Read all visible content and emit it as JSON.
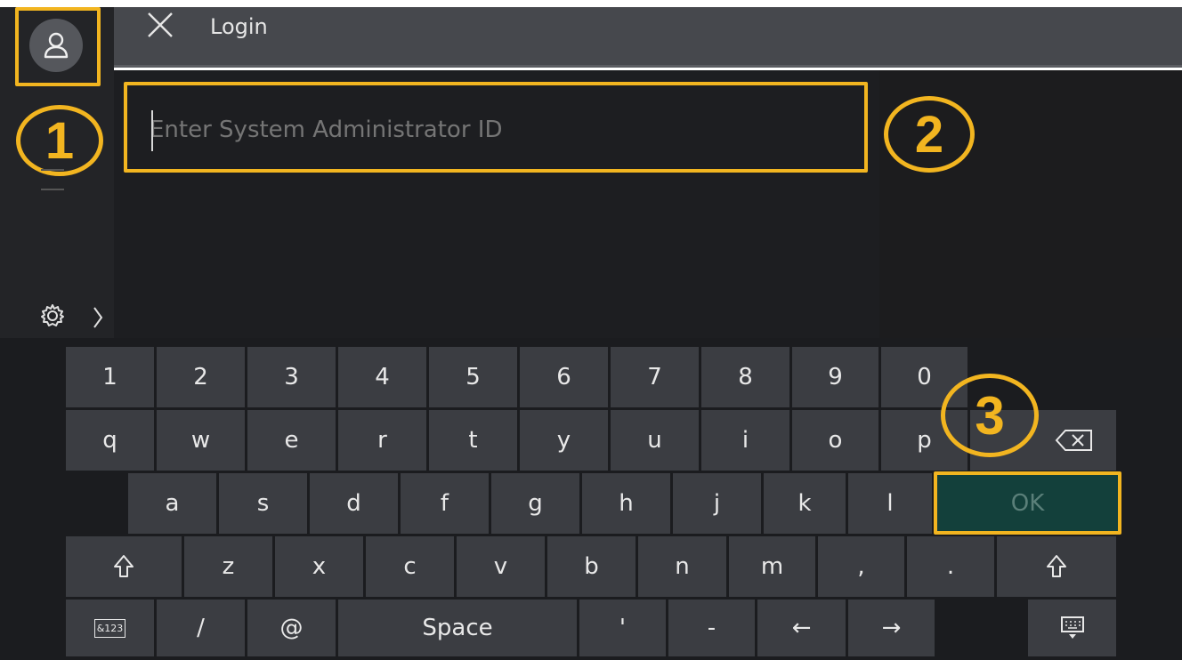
{
  "header": {
    "title": "Login"
  },
  "login": {
    "placeholder": "Enter System Administrator ID"
  },
  "annotations": {
    "one": "1",
    "two": "2",
    "three": "3"
  },
  "keyboard": {
    "row1": [
      "1",
      "2",
      "3",
      "4",
      "5",
      "6",
      "7",
      "8",
      "9",
      "0"
    ],
    "row2": [
      "q",
      "w",
      "e",
      "r",
      "t",
      "y",
      "u",
      "i",
      "o",
      "p"
    ],
    "row3": [
      "a",
      "s",
      "d",
      "f",
      "g",
      "h",
      "j",
      "k",
      "l"
    ],
    "ok_label": "OK",
    "row4": [
      "z",
      "x",
      "c",
      "v",
      "b",
      "n",
      "m",
      ",",
      "."
    ],
    "row5": {
      "symbols": "&123",
      "slash": "/",
      "at": "@",
      "space": "Space",
      "apostrophe": "'",
      "hyphen": "-",
      "left": "←",
      "right": "→"
    }
  },
  "colors": {
    "highlight": "#f2b520",
    "ok_bg": "#13403b"
  },
  "icons": [
    "user-icon",
    "close-icon",
    "gear-icon",
    "chevron-right-icon",
    "shift-icon",
    "backspace-icon",
    "keyboard-hide-icon"
  ]
}
